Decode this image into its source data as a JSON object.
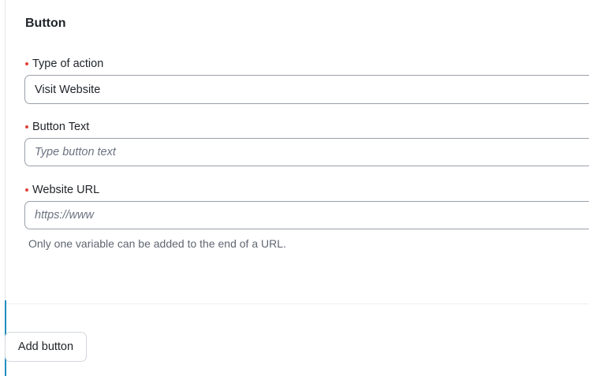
{
  "section": {
    "title": "Button"
  },
  "fields": {
    "action_type": {
      "label": "Type of action",
      "value": "Visit Website"
    },
    "button_text": {
      "label": "Button Text",
      "placeholder": "Type button text",
      "value": ""
    },
    "website_url": {
      "label": "Website URL",
      "placeholder": "https://www",
      "value": "",
      "helper": "Only one variable can be added to the end of a URL."
    }
  },
  "actions": {
    "add_button_label": "Add button"
  },
  "colors": {
    "required": "#e0443a",
    "accent": "#1f8fbf",
    "field_border": "#9aa0a8"
  }
}
